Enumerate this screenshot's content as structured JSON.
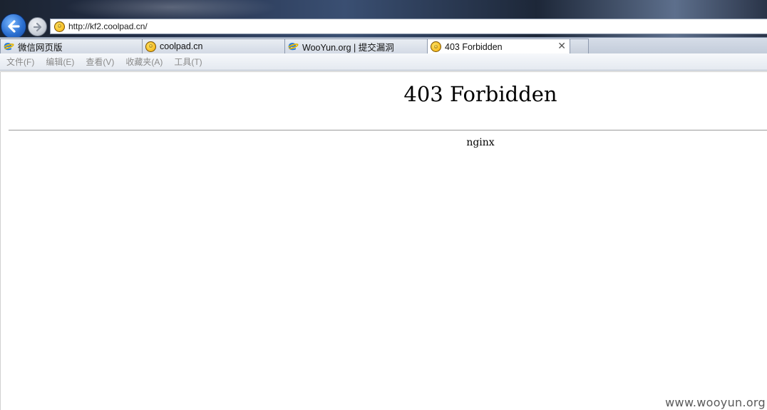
{
  "browser": {
    "address_url": "http://kf2.coolpad.cn/",
    "tabs": [
      {
        "label": "微信网页版",
        "icon": "ie-icon"
      },
      {
        "label": "coolpad.cn",
        "icon": "smiley-favicon-icon"
      },
      {
        "label": "WooYun.org | 提交漏洞",
        "icon": "ie-icon"
      },
      {
        "label": "403 Forbidden",
        "icon": "smiley-favicon-icon",
        "active": true
      }
    ],
    "close_tab_glyph": "✕",
    "menu": [
      "文件(F)",
      "编辑(E)",
      "查看(V)",
      "收藏夹(A)",
      "工具(T)"
    ]
  },
  "page": {
    "title": "403 Forbidden",
    "server": "nginx"
  },
  "watermark": "www.wooyun.org"
}
